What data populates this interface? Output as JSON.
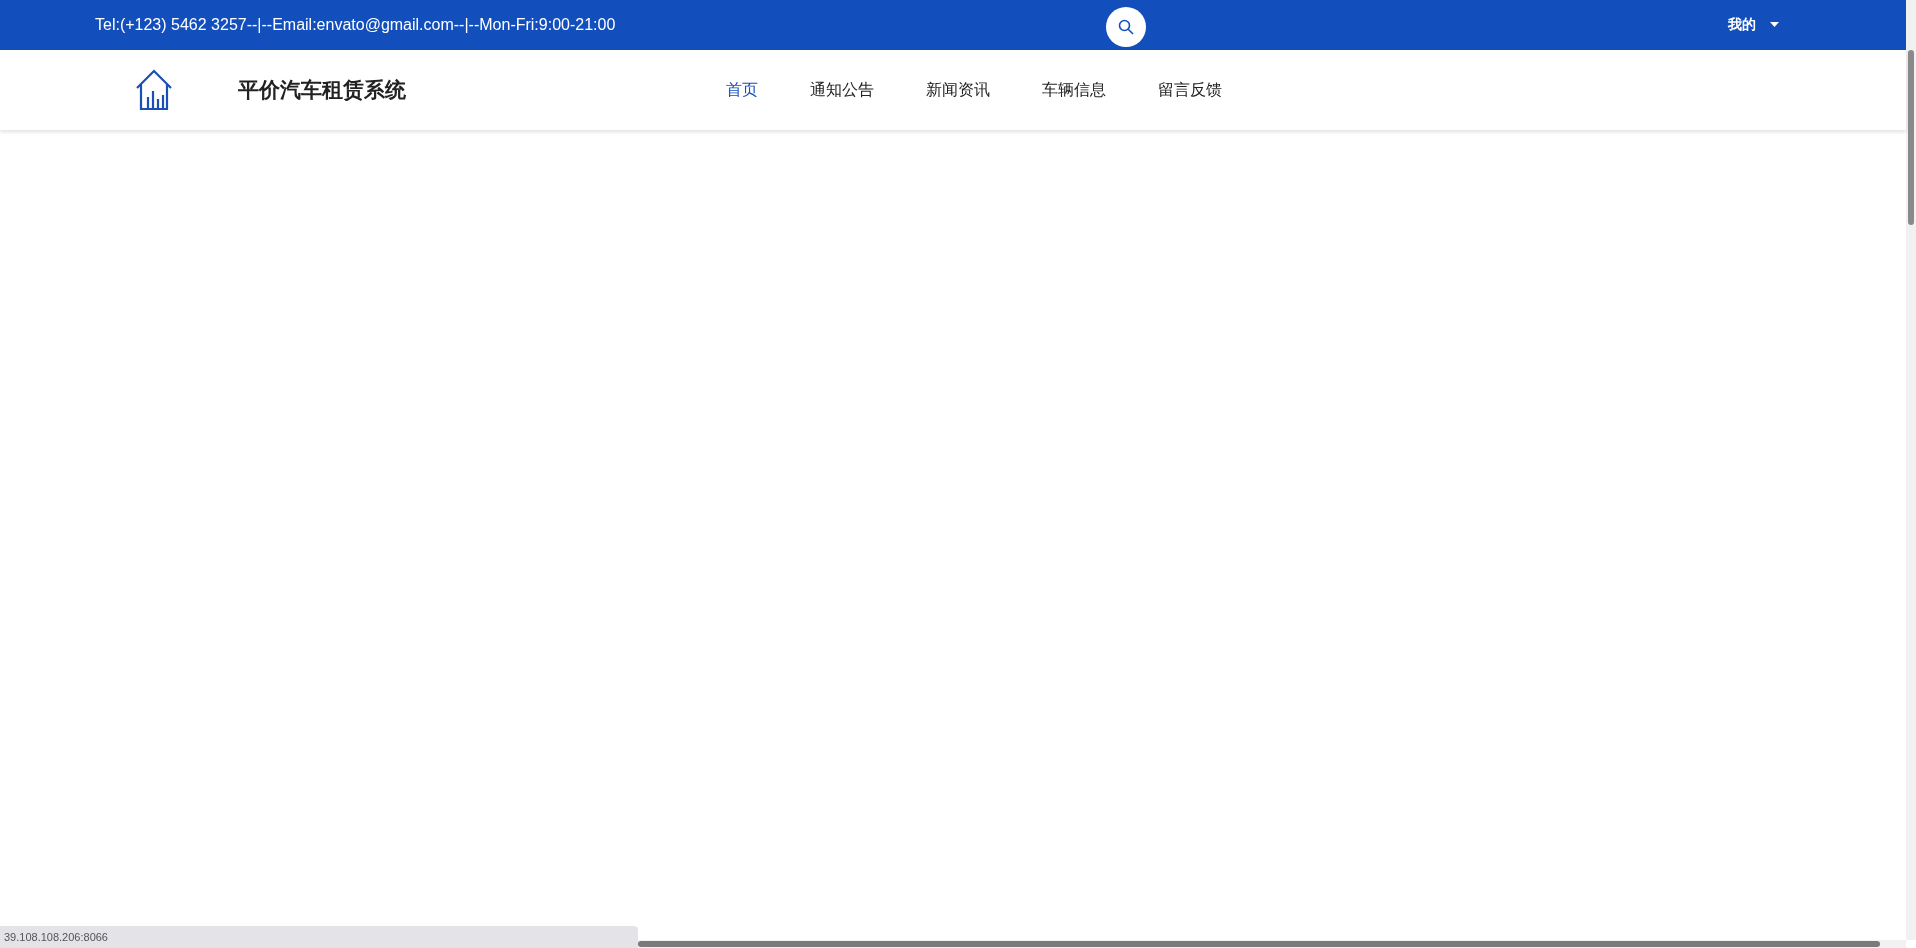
{
  "top_bar": {
    "contact_text": "Tel:(+123) 5462 3257--|--Email:envato@gmail.com--|--Mon-Fri:9:00-21:00",
    "account_menu": {
      "label": "我的"
    }
  },
  "header": {
    "site_title": "平价汽车租赁系统",
    "nav": [
      {
        "label": "首页",
        "selected": true
      },
      {
        "label": "通知公告",
        "selected": false
      },
      {
        "label": "新闻资讯",
        "selected": false
      },
      {
        "label": "车辆信息",
        "selected": false
      },
      {
        "label": "留言反馈",
        "selected": false
      }
    ]
  },
  "status_url": "39.108.108.206:8066"
}
